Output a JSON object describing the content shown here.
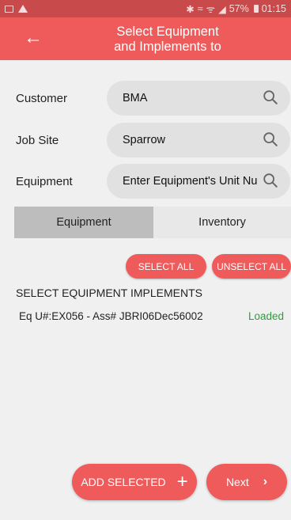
{
  "status_bar": {
    "battery": "57%",
    "time": "01:15",
    "icons": [
      "gallery-icon",
      "warning-icon",
      "bluetooth-icon",
      "mute-icon",
      "wifi-icon",
      "signal-icon",
      "battery-icon"
    ]
  },
  "header": {
    "title_line1": "Select Equipment",
    "title_line2": "and Implements to",
    "back_icon": "arrow-left-icon",
    "color": "#ef5b5b"
  },
  "form": {
    "customer": {
      "label": "Customer",
      "value": "BMA"
    },
    "job_site": {
      "label": "Job Site",
      "value": "Sparrow"
    },
    "equipment": {
      "label": "Equipment",
      "placeholder": "Enter Equipment's Unit Nu"
    }
  },
  "tabs": [
    {
      "label": "Equipment",
      "selected": true
    },
    {
      "label": "Inventory",
      "selected": false
    }
  ],
  "actions": {
    "select_all": "SELECT ALL",
    "unselect_all": "UNSELECT ALL"
  },
  "section": {
    "header": "SELECT EQUIPMENT IMPLEMENTS",
    "items": [
      {
        "text": "Eq U#:EX056 - Ass#  JBRI06Dec56002",
        "status": "Loaded",
        "status_color": "#2e9c3a"
      }
    ]
  },
  "footer": {
    "add_selected": "ADD SELECTED",
    "next": "Next"
  }
}
